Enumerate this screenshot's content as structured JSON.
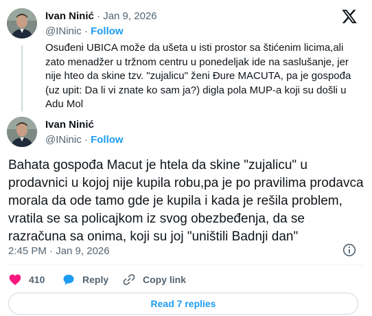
{
  "quoted_tweet": {
    "author_name": "Ivan Ninić",
    "separator": " · ",
    "date": "Jan 9, 2026",
    "handle": "@INinic",
    "handle_separator": " · ",
    "follow_label": "Follow",
    "text": "Osuđeni UBICA može da ušeta u isti prostor sa štićenim licima,ali zato menadžer u tržnom centru u ponedeljak ide na saslušanje, jer nije hteo da skine tzv. \"zujalicu\" ženi Đure MACUTA, pa je gospođa (uz upit: Da li vi znate ko sam ja?) digla pola MUP-a koji su došli u Adu Mol"
  },
  "main_tweet": {
    "author_name": "Ivan Ninić",
    "handle": "@INinic",
    "handle_separator": " · ",
    "follow_label": "Follow",
    "text": "Bahata gospođa Macut je htela da skine \"zujalicu\" u prodavnici u kojoj nije kupila robu,pa je po pravilima prodavca morala da ode tamo gde je kupila i kada je rešila problem, vratila se sa policajkom iz svog obezbeđenja, da se razračuna sa onima, koji su joj \"uništili Badnji dan\"",
    "timestamp": "2:45 PM · Jan 9, 2026"
  },
  "actions": {
    "like_count": "410",
    "reply_label": "Reply",
    "copy_link_label": "Copy link"
  },
  "read_replies_label": "Read 7 replies",
  "icons": {
    "logo": "x-logo-icon",
    "info": "info-icon",
    "like": "heart-icon",
    "reply": "reply-bubble-icon",
    "copy_link": "link-icon"
  },
  "colors": {
    "accent": "#1d9bf0",
    "like": "#f91880",
    "text": "#0f1419",
    "muted": "#536471",
    "border": "#cfd9de"
  }
}
